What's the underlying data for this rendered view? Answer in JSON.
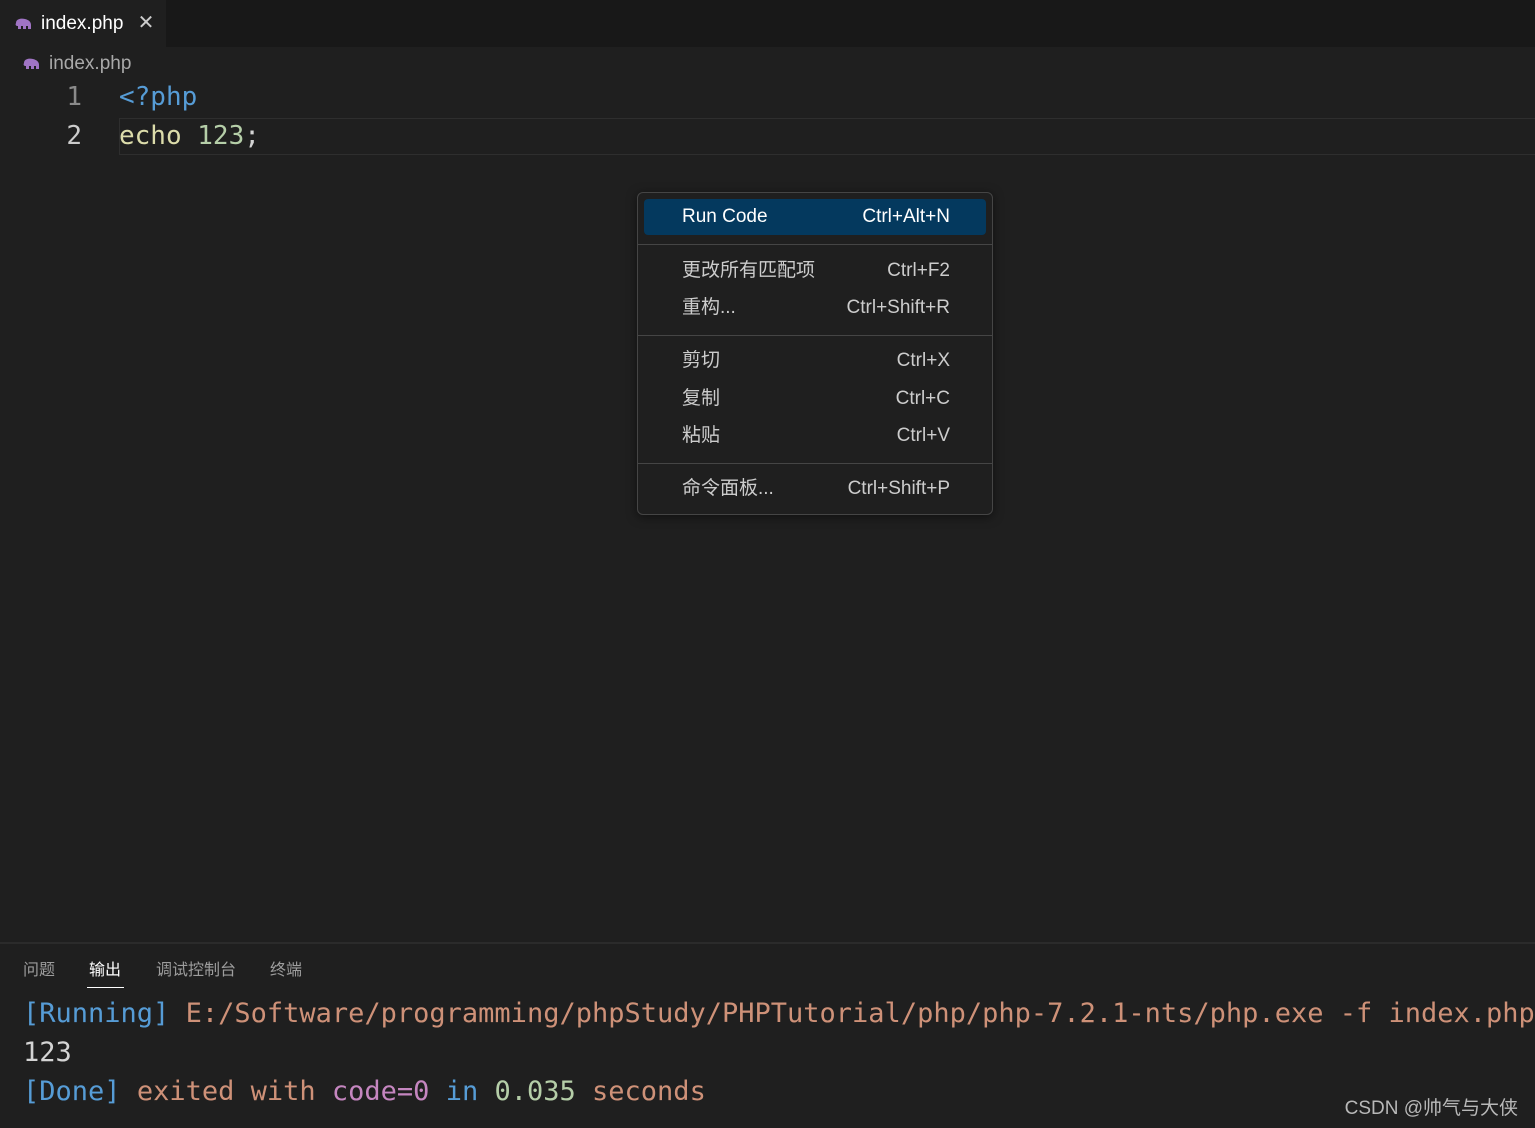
{
  "tab": {
    "label": "index.php",
    "icon": "php-elephant-icon",
    "close_glyph": "✕"
  },
  "breadcrumb": {
    "label": "index.php",
    "icon": "php-elephant-icon"
  },
  "editor": {
    "lines": [
      {
        "number": "1",
        "code": "<?php"
      },
      {
        "number": "2",
        "code_keyword": "echo",
        "code_number": "123",
        "code_punct": ";"
      }
    ]
  },
  "context_menu": {
    "items": [
      {
        "label": "Run Code",
        "shortcut": "Ctrl+Alt+N"
      },
      {
        "label": "更改所有匹配项",
        "shortcut": "Ctrl+F2"
      },
      {
        "label": "重构...",
        "shortcut": "Ctrl+Shift+R"
      },
      {
        "label": "剪切",
        "shortcut": "Ctrl+X"
      },
      {
        "label": "复制",
        "shortcut": "Ctrl+C"
      },
      {
        "label": "粘贴",
        "shortcut": "Ctrl+V"
      },
      {
        "label": "命令面板...",
        "shortcut": "Ctrl+Shift+P"
      }
    ]
  },
  "panel": {
    "tabs": [
      "问题",
      "输出",
      "调试控制台",
      "终端"
    ],
    "active_tab": "输出",
    "output": {
      "running_tag": "[Running]",
      "running_cmd": "E:/Software/programming/phpStudy/PHPTutorial/php/php-7.2.1-nts/php.exe -f index.php",
      "result": "123",
      "done_tag": "[Done]",
      "done_exited": "exited with",
      "done_code": "code=0",
      "done_in": "in",
      "done_time": "0.035",
      "done_seconds": "seconds"
    }
  },
  "watermark": "CSDN @帅气与大侠",
  "colors": {
    "editor_bg": "#1f1f1f",
    "tabbar_bg": "#181818",
    "menu_highlight": "#04395e",
    "php_tag": "#569cd6",
    "keyword": "#dcdcaa",
    "number": "#b5cea8",
    "output_blue": "#569cd6",
    "output_orange": "#ce9178",
    "output_purple": "#c586c0",
    "php_icon": "#a074c4"
  }
}
